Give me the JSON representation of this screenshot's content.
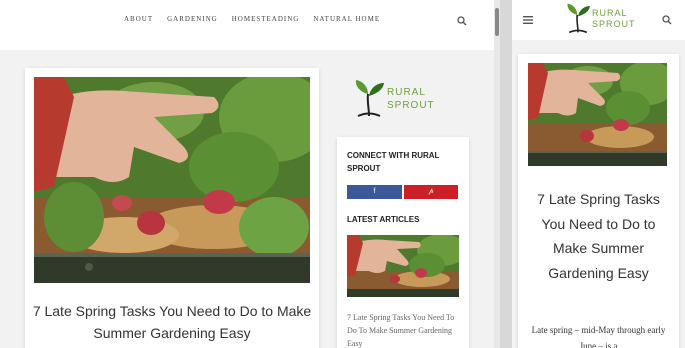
{
  "desktop": {
    "nav": [
      {
        "label": "ABOUT"
      },
      {
        "label": "GARDENING"
      },
      {
        "label": "HOMESTEADING"
      },
      {
        "label": "NATURAL HOME"
      }
    ],
    "search_icon": "search-icon",
    "brand": {
      "line1": "RURAL",
      "line2": "SPROUT"
    },
    "article_title": "7 Late Spring Tasks You Need to Do to Make Summer Gardening Easy",
    "sidebar": {
      "connect_heading": "CONNECT WITH RURAL SPROUT",
      "facebook_label": "f",
      "pinterest_label": "𝓅",
      "latest_heading": "LATEST ARTICLES",
      "latest_link": "7 Late Spring Tasks You Need To Do To Make Summer Gardening Easy"
    }
  },
  "mobile": {
    "menu_icon": "hamburger-menu-icon",
    "search_icon": "search-icon",
    "brand": {
      "line1": "RURAL",
      "line2": "SPROUT"
    },
    "article_title": "7 Late Spring Tasks You Need to Do to Make Summer Gardening Easy",
    "excerpt": "Late spring – mid-May through early June – is a"
  },
  "colors": {
    "brand_green": "#6ea03c",
    "facebook": "#3b5998",
    "pinterest": "#cb2027"
  }
}
